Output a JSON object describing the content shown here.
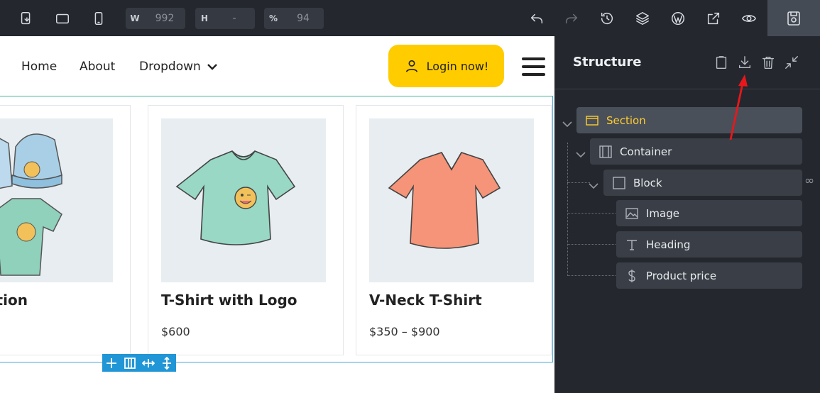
{
  "toolbar": {
    "width_label": "W",
    "width_value": "992",
    "height_label": "H",
    "height_value": "-",
    "zoom_label": "%",
    "zoom_value": "94"
  },
  "nav": {
    "items": [
      "Home",
      "About",
      "Dropdown"
    ],
    "login_label": "Login now!"
  },
  "products": [
    {
      "title": "Collection",
      "price": ""
    },
    {
      "title": "T-Shirt with Logo",
      "price": "$600"
    },
    {
      "title": "V-Neck T-Shirt",
      "price": "$350 – $900"
    }
  ],
  "structure": {
    "title": "Structure",
    "nodes": [
      {
        "label": "Section",
        "icon": "section-icon",
        "selected": true
      },
      {
        "label": "Container",
        "icon": "container-icon"
      },
      {
        "label": "Block",
        "icon": "block-icon"
      },
      {
        "label": "Image",
        "icon": "image-icon"
      },
      {
        "label": "Heading",
        "icon": "heading-icon"
      },
      {
        "label": "Product price",
        "icon": "dollar-icon"
      }
    ],
    "link_symbol": "∞"
  },
  "colors": {
    "toolbar_bg": "#24282e",
    "accent_yellow": "#ffcc00",
    "selection_blue": "#2196d6",
    "annotation_red": "#e8171b"
  }
}
